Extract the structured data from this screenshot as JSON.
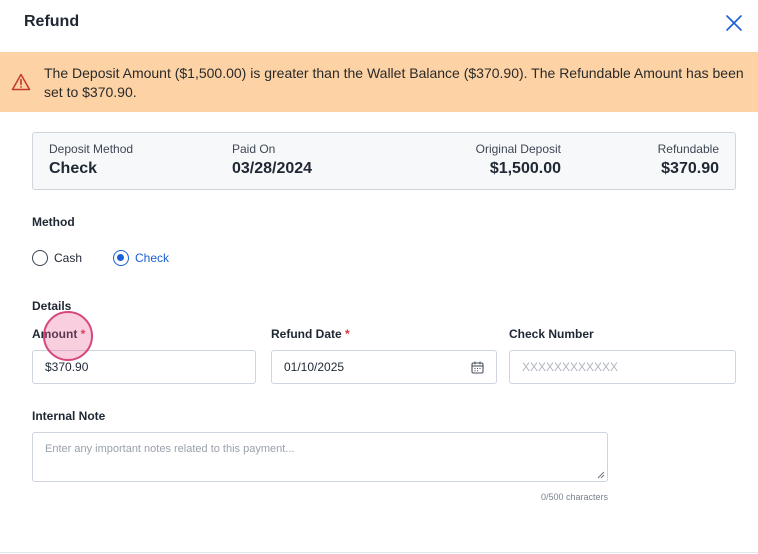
{
  "dialog": {
    "title": "Refund",
    "close_icon": "close-icon"
  },
  "warning": {
    "icon": "warning-triangle-icon",
    "text": "The Deposit Amount ($1,500.00) is greater than the Wallet Balance ($370.90). The Refundable Amount has been set to $370.90.",
    "color": "#fdd3a5"
  },
  "summary": {
    "deposit_method_label": "Deposit Method",
    "deposit_method_value": "Check",
    "paid_on_label": "Paid On",
    "paid_on_value": "03/28/2024",
    "original_deposit_label": "Original Deposit",
    "original_deposit_value": "$1,500.00",
    "refundable_label": "Refundable",
    "refundable_value": "$370.90"
  },
  "method": {
    "label": "Method",
    "options": [
      {
        "label": "Cash",
        "selected": false
      },
      {
        "label": "Check",
        "selected": true
      }
    ],
    "accent_color": "#1a5fd6"
  },
  "details": {
    "label": "Details",
    "amount": {
      "label": "Amount",
      "required_mark": "*",
      "value": "$370.90"
    },
    "refund_date": {
      "label": "Refund Date",
      "required_mark": "*",
      "value": "01/10/2025",
      "icon": "calendar-icon"
    },
    "check_number": {
      "label": "Check Number",
      "placeholder": "XXXXXXXXXXXX"
    }
  },
  "internal_note": {
    "label": "Internal Note",
    "placeholder": "Enter any important notes related to this payment...",
    "char_count": "0/500 characters"
  }
}
